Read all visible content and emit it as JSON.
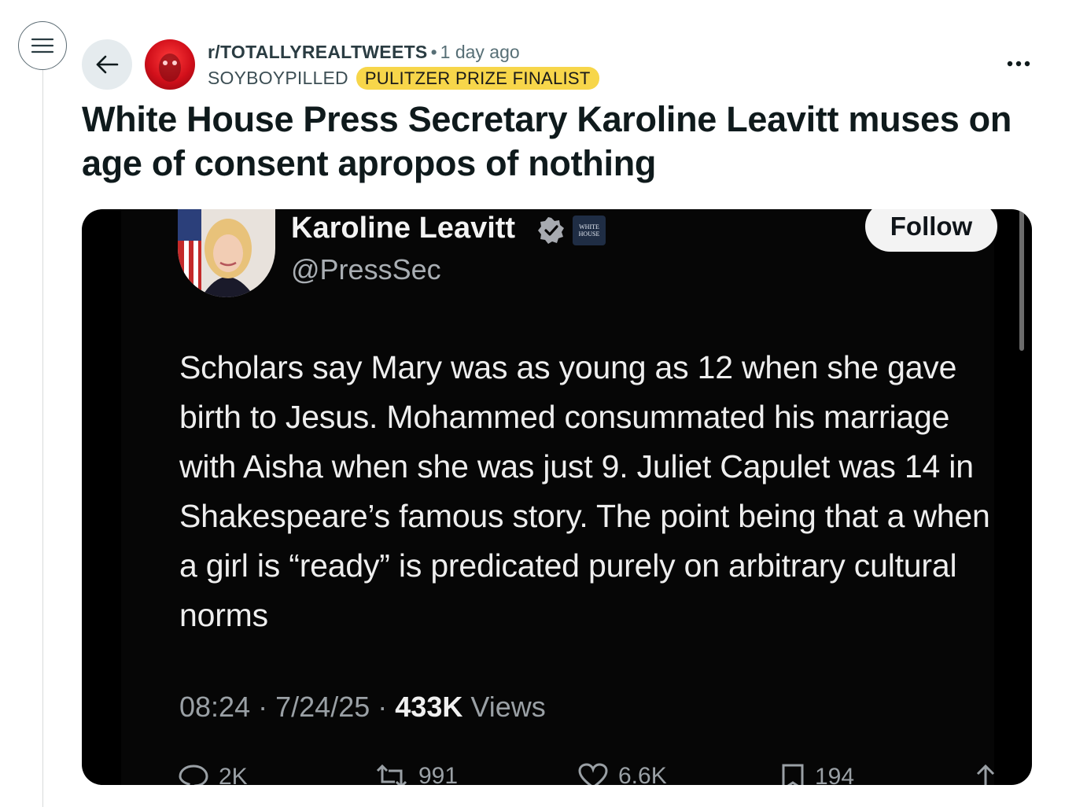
{
  "header": {
    "subreddit": "r/TOTALLYREALTWEETS",
    "separator": "•",
    "time": "1 day ago",
    "username": "SOYBOYPILLED",
    "flair": "PULITZER PRIZE FINALIST",
    "flair_color": "#f7d64a"
  },
  "post": {
    "title": "White House Press Secretary Karoline Leavitt muses on age of consent apropos of nothing"
  },
  "tweet": {
    "name": "Karoline Leavitt",
    "handle": "@PressSec",
    "badge_text": "WHITE HOUSE",
    "follow_label": "Follow",
    "text": "Scholars say Mary was as young as 12 when she gave birth to Jesus. Mohammed consummated his marriage with Aisha when she was just 9. Juliet Capulet was 14 in Shakespeare’s famous story. The point being that a when a girl is “ready” is predicated purely on arbitrary cultural norms",
    "time": "08:24",
    "date": "7/24/25",
    "views_count": "433K",
    "views_label": "Views",
    "dot": "·",
    "actions": {
      "replies": "2K",
      "reposts": "991",
      "likes": "6.6K",
      "bookmarks": "194"
    }
  },
  "icons": {
    "menu": "hamburger-menu-icon",
    "back": "arrow-left-icon",
    "more": "more-horizontal-icon",
    "verified": "verified-badge-icon",
    "reply": "reply-bubble-icon",
    "repost": "repost-icon",
    "like": "heart-icon",
    "bookmark": "bookmark-icon",
    "share": "share-arrow-icon"
  },
  "colors": {
    "verified": "#a7aab0",
    "tweet_bg": "#060606"
  }
}
